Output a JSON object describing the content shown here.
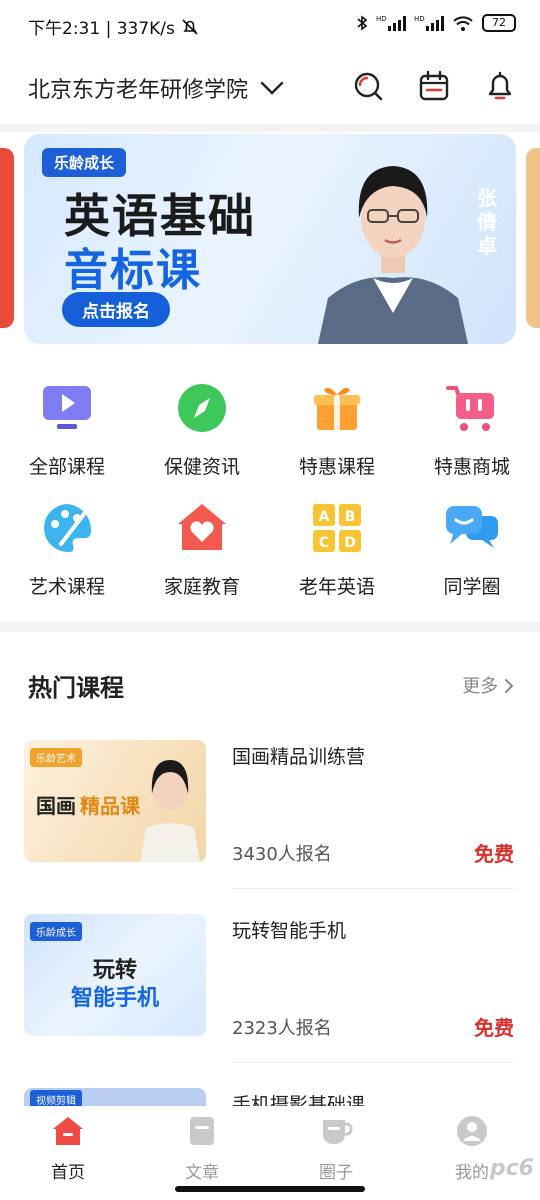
{
  "status_bar": {
    "time_speed": "下午2:31 | 337K/s",
    "battery": "72",
    "signal_label_1": "HD",
    "signal_label_2": "HD"
  },
  "header": {
    "org_name": "北京东方老年研修学院"
  },
  "banner": {
    "tag": "乐龄成长",
    "title_line1": "英语基础",
    "title_line2": "音标课",
    "cta": "点击报名",
    "teacher": "张倩卓"
  },
  "menu": [
    {
      "label": "全部课程",
      "icon": "video-course-icon"
    },
    {
      "label": "保健资讯",
      "icon": "compass-icon"
    },
    {
      "label": "特惠课程",
      "icon": "gift-icon"
    },
    {
      "label": "特惠商城",
      "icon": "shopping-cart-icon"
    },
    {
      "label": "艺术课程",
      "icon": "palette-icon"
    },
    {
      "label": "家庭教育",
      "icon": "home-heart-icon"
    },
    {
      "label": "老年英语",
      "icon": "abcd-icon"
    },
    {
      "label": "同学圈",
      "icon": "chat-bubbles-icon"
    }
  ],
  "hot": {
    "title": "热门课程",
    "more": "更多"
  },
  "courses": [
    {
      "title": "国画精品训练营",
      "count": "3430人报名",
      "price": "免费",
      "thumb_tag": "乐龄艺术",
      "thumb_text_a": "国画",
      "thumb_text_b": "精品课"
    },
    {
      "title": "玩转智能手机",
      "count": "2323人报名",
      "price": "免费",
      "thumb_tag": "乐龄成长",
      "thumb_text_a": "玩转",
      "thumb_text_b": "智能手机"
    },
    {
      "title": "手机摄影基础课",
      "count": "",
      "price": "",
      "thumb_tag": "视频剪辑",
      "thumb_text_a": "",
      "thumb_text_b": ""
    }
  ],
  "tabbar": [
    {
      "label": "首页",
      "icon": "home-icon",
      "active": true
    },
    {
      "label": "文章",
      "icon": "article-icon",
      "active": false
    },
    {
      "label": "圈子",
      "icon": "cup-icon",
      "active": false
    },
    {
      "label": "我的",
      "icon": "user-icon",
      "active": false
    }
  ],
  "watermark": "pc6",
  "colors": {
    "accent_red": "#d9302c",
    "banner_blue": "#1565e0"
  }
}
